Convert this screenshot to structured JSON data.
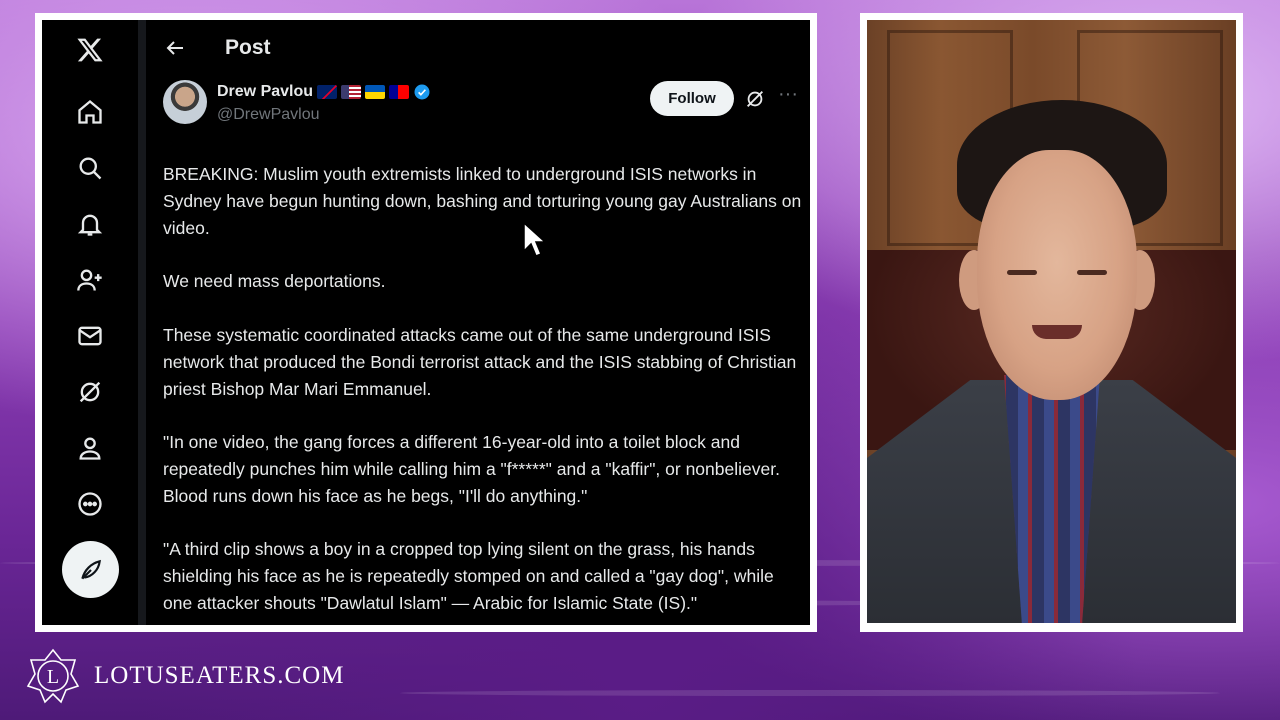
{
  "post": {
    "header_title": "Post",
    "author": {
      "name": "Drew Pavlou",
      "handle": "@DrewPavlou",
      "flags": [
        "Australia",
        "United States",
        "Ukraine",
        "Taiwan"
      ]
    },
    "follow_label": "Follow",
    "more_label": "···",
    "paragraphs": [
      "BREAKING: Muslim youth extremists linked to underground ISIS networks in Sydney have begun hunting down, bashing and torturing young gay Australians on video.",
      "We need mass deportations.",
      "These systematic coordinated attacks came out of the same underground ISIS network that produced the Bondi terrorist attack and the ISIS stabbing of Christian priest Bishop Mar Mari Emmanuel.",
      "\"In one video, the gang forces a different 16-year-old into a toilet block and repeatedly punches him while calling him a \"f*****\" and a \"kaffir\", or nonbeliever. Blood runs down his face as he begs, \"I'll do anything.\"",
      "\"A third clip shows a boy in a cropped top lying silent on the grass, his hands shielding his face as he is repeatedly stomped on and called a \"gay dog\", while one attacker shouts \"Dawlatul Islam\" — Arabic for Islamic State (IS).\""
    ]
  },
  "nav": {
    "items": [
      "x-logo-icon",
      "home-icon",
      "search-icon",
      "bell-icon",
      "people-icon",
      "mail-icon",
      "grok-icon",
      "profile-icon",
      "more-icon",
      "compose-icon"
    ]
  },
  "branding": {
    "logo_letter": "L",
    "site": "LOTUSEATERS.COM"
  },
  "colors": {
    "background_accent": "#8a3fb0",
    "post_background": "#000000",
    "text_primary": "#e7e9ea",
    "text_secondary": "#71767b",
    "verified": "#1d9bf0"
  }
}
